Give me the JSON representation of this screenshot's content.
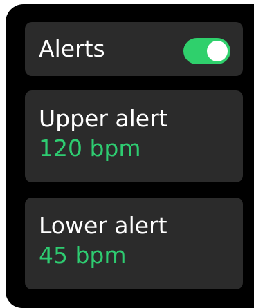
{
  "alerts": {
    "label": "Alerts",
    "toggle_on": true
  },
  "upper_alert": {
    "label": "Upper alert",
    "value": "120 bpm"
  },
  "lower_alert": {
    "label": "Lower alert",
    "value": "45 bpm"
  },
  "colors": {
    "accent": "#2ecc71",
    "card_background": "#2b2b2b",
    "screen_background": "#000000"
  }
}
